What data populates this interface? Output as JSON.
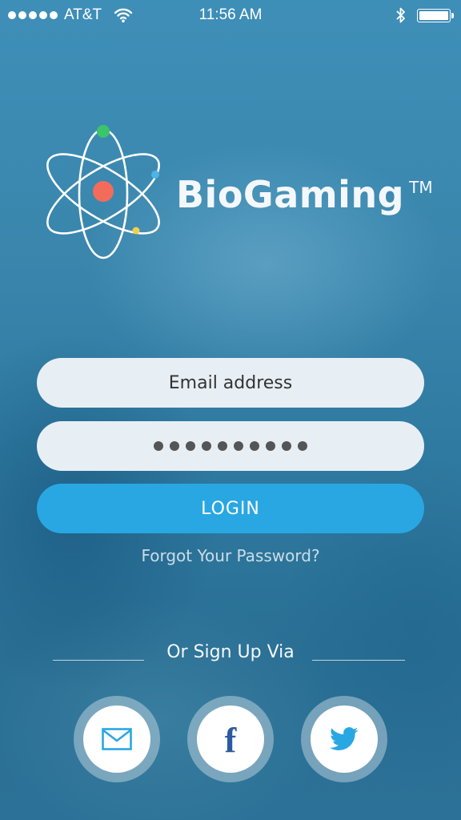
{
  "status_bar": {
    "carrier": "AT&T",
    "time": "11:56 AM",
    "signal_bars": 5,
    "icons": [
      "wifi-icon",
      "bluetooth-icon",
      "battery-icon"
    ]
  },
  "brand": {
    "name": "BioGaming",
    "trademark": "TM",
    "logo_icon": "atom-icon"
  },
  "login_form": {
    "email_placeholder": "Email address",
    "password_masked": "●●●●●●●●●●",
    "password_length": 10,
    "login_label": "LOGIN",
    "forgot_label": "Forgot Your Password?"
  },
  "signup": {
    "label": "Or Sign Up Via",
    "options": [
      {
        "name": "email",
        "icon": "mail-icon"
      },
      {
        "name": "facebook",
        "icon": "facebook-icon",
        "glyph": "f"
      },
      {
        "name": "twitter",
        "icon": "twitter-icon"
      }
    ]
  },
  "colors": {
    "login_button": "#29a7e3",
    "field_background": "#e8eff4",
    "atom_nucleus": "#f26b5b",
    "electron_green": "#3cc46b",
    "electron_blue": "#4fb3e6",
    "electron_yellow": "#f2d04a",
    "facebook_blue": "#2b5aa0",
    "twitter_blue": "#29a7e3"
  }
}
